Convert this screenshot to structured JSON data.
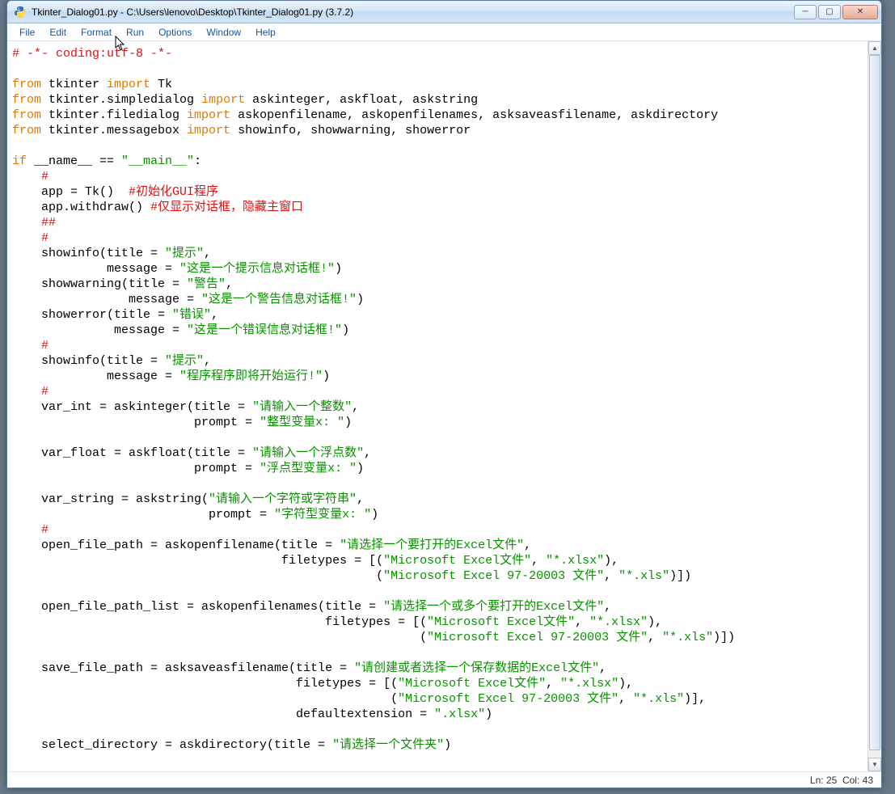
{
  "title": "Tkinter_Dialog01.py - C:\\Users\\lenovo\\Desktop\\Tkinter_Dialog01.py (3.7.2)",
  "menu": [
    "File",
    "Edit",
    "Format",
    "Run",
    "Options",
    "Window",
    "Help"
  ],
  "status": {
    "ln": "Ln: 25",
    "col": "Col: 43"
  },
  "code": {
    "l1": "# -*- coding:utf-8 -*-",
    "l3a": "from",
    "l3b": " tkinter ",
    "l3c": "import",
    "l3d": " Tk",
    "l4a": "from",
    "l4b": " tkinter.simpledialog ",
    "l4c": "import",
    "l4d": " askinteger, askfloat, askstring",
    "l5a": "from",
    "l5b": " tkinter.filedialog ",
    "l5c": "import",
    "l5d": " askopenfilename, askopenfilenames, asksaveasfilename, askdirectory",
    "l6a": "from",
    "l6b": " tkinter.messagebox ",
    "l6c": "import",
    "l6d": " showinfo, showwarning, showerror",
    "l8a": "if",
    "l8b": " __name__ == ",
    "l8c": "\"__main__\"",
    "l8d": ":",
    "l9": "    #",
    "l10a": "    app = Tk()  ",
    "l10b": "#初始化GUI程序",
    "l11a": "    app.withdraw() ",
    "l11b": "#仅显示对话框，隐藏主窗口",
    "l12": "    ##",
    "l13": "    #",
    "l14a": "    showinfo(title = ",
    "l14b": "\"提示\"",
    "l14c": ",",
    "l15a": "             message = ",
    "l15b": "\"这是一个提示信息对话框!\"",
    "l15c": ")",
    "l16a": "    showwarning(title = ",
    "l16b": "\"警告\"",
    "l16c": ",",
    "l17a": "                message = ",
    "l17b": "\"这是一个警告信息对话框!\"",
    "l17c": ")",
    "l18a": "    showerror(title = ",
    "l18b": "\"错误\"",
    "l18c": ",",
    "l19a": "              message = ",
    "l19b": "\"这是一个错误信息对话框!\"",
    "l19c": ")",
    "l20": "    #",
    "l21a": "    showinfo(title = ",
    "l21b": "\"提示\"",
    "l21c": ",",
    "l22a": "             message = ",
    "l22b": "\"程序程序即将开始运行!\"",
    "l22c": ")",
    "l23": "    #",
    "l24a": "    var_int = askinteger(title = ",
    "l24b": "\"请输入一个整数\"",
    "l24c": ",",
    "l25a": "                         prompt = ",
    "l25b": "\"整型变量x: \"",
    "l25c": ")",
    "l27a": "    var_float = askfloat(title = ",
    "l27b": "\"请输入一个浮点数\"",
    "l27c": ",",
    "l28a": "                         prompt = ",
    "l28b": "\"浮点型变量x: \"",
    "l28c": ")",
    "l30a": "    var_string = askstring(",
    "l30b": "\"请输入一个字符或字符串\"",
    "l30c": ",",
    "l31a": "                           prompt = ",
    "l31b": "\"字符型变量x: \"",
    "l31c": ")",
    "l32": "    #",
    "l33a": "    open_file_path = askopenfilename(title = ",
    "l33b": "\"请选择一个要打开的Excel文件\"",
    "l33c": ",",
    "l34a": "                                     filetypes = [(",
    "l34b": "\"Microsoft Excel文件\"",
    "l34c": ", ",
    "l34d": "\"*.xlsx\"",
    "l34e": "),",
    "l35a": "                                                  (",
    "l35b": "\"Microsoft Excel 97-20003 文件\"",
    "l35c": ", ",
    "l35d": "\"*.xls\"",
    "l35e": ")])",
    "l37a": "    open_file_path_list = askopenfilenames(title = ",
    "l37b": "\"请选择一个或多个要打开的Excel文件\"",
    "l37c": ",",
    "l38a": "                                           filetypes = [(",
    "l38b": "\"Microsoft Excel文件\"",
    "l38c": ", ",
    "l38d": "\"*.xlsx\"",
    "l38e": "),",
    "l39a": "                                                        (",
    "l39b": "\"Microsoft Excel 97-20003 文件\"",
    "l39c": ", ",
    "l39d": "\"*.xls\"",
    "l39e": ")])",
    "l41a": "    save_file_path = asksaveasfilename(title = ",
    "l41b": "\"请创建或者选择一个保存数据的Excel文件\"",
    "l41c": ",",
    "l42a": "                                       filetypes = [(",
    "l42b": "\"Microsoft Excel文件\"",
    "l42c": ", ",
    "l42d": "\"*.xlsx\"",
    "l42e": "),",
    "l43a": "                                                    (",
    "l43b": "\"Microsoft Excel 97-20003 文件\"",
    "l43c": ", ",
    "l43d": "\"*.xls\"",
    "l43e": ")],",
    "l44a": "                                       defaultextension = ",
    "l44b": "\".xlsx\"",
    "l44c": ")",
    "l46a": "    select_directory = askdirectory(title = ",
    "l46b": "\"请选择一个文件夹\"",
    "l46c": ")"
  }
}
